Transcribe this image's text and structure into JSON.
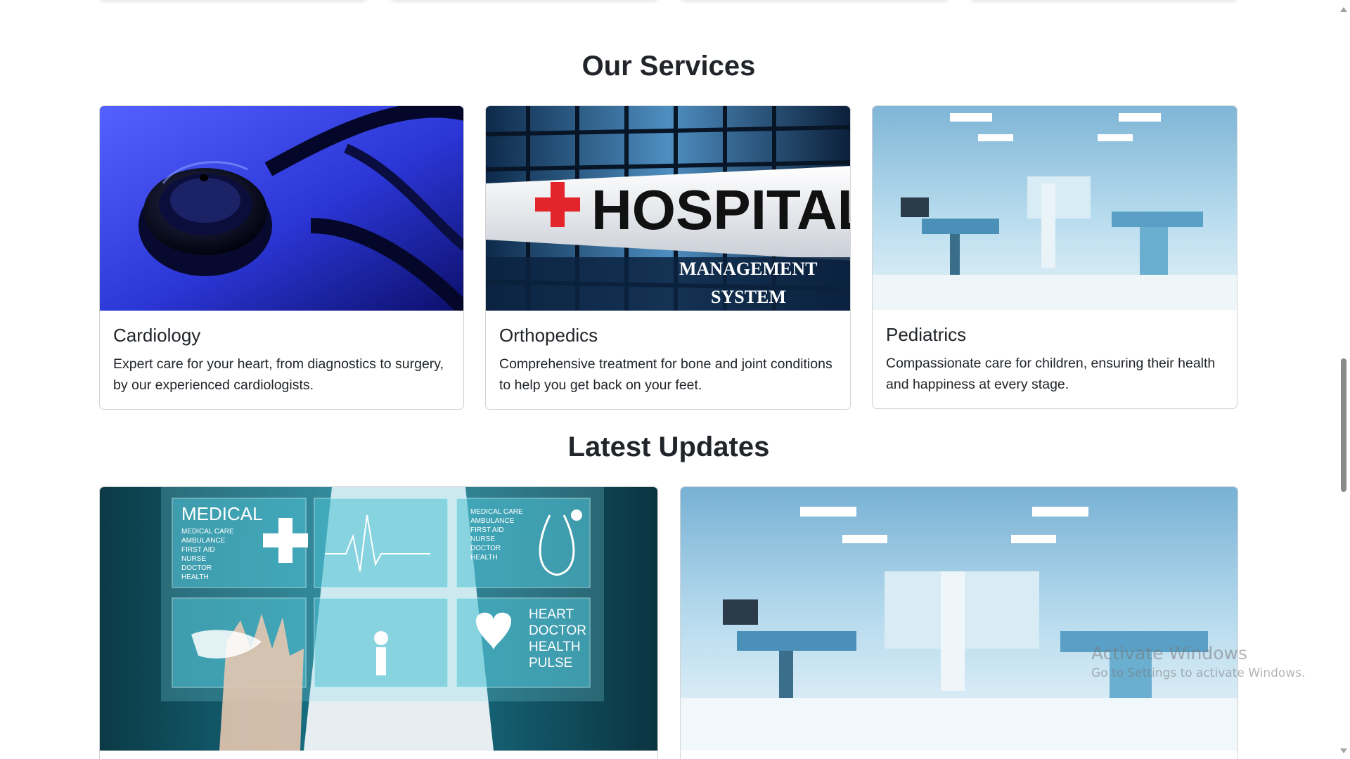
{
  "services": {
    "title": "Our Services",
    "cards": [
      {
        "title": "Cardiology",
        "text": "Expert care for your heart, from diagnostics to surgery, by our experienced cardiologists.",
        "image": "stethoscope-image"
      },
      {
        "title": "Orthopedics",
        "text": "Comprehensive treatment for bone and joint conditions to help you get back on your feet.",
        "image": "hospital-building-image",
        "image_text": {
          "sign": "HOSPITAL",
          "line1": "MANAGEMENT",
          "line2": "SYSTEM"
        }
      },
      {
        "title": "Pediatrics",
        "text": "Compassionate care for children, ensuring their health and happiness at every stage.",
        "image": "operating-room-image"
      }
    ]
  },
  "updates": {
    "title": "Latest Updates",
    "cards": [
      {
        "image": "medical-digital-interface-image",
        "image_text": {
          "medical": "MEDICAL",
          "medical_list": [
            "MEDICAL CARE",
            "AMBULANCE",
            "FIRST AID",
            "NURSE",
            "DOCTOR",
            "HEALTH"
          ],
          "list2": [
            "MEDICAL CARE",
            "AMBULANCE",
            "FIRST AID",
            "NURSE",
            "DOCTOR",
            "HEALTH"
          ],
          "heart_list": [
            "HEART",
            "DOCTOR",
            "HEALTH",
            "PULSE"
          ]
        }
      },
      {
        "image": "operating-room-image"
      }
    ]
  },
  "watermark": {
    "line1": "Activate Windows",
    "line2": "Go to Settings to activate Windows."
  },
  "colors": {
    "heading": "#212529",
    "card_border": "rgba(0,0,0,0.175)",
    "cardiology_blue": "#2f3fd0",
    "hospital_cross": "#e3242b",
    "room_blue": "#a9d3ea",
    "medical_teal": "#1aa3b8"
  }
}
